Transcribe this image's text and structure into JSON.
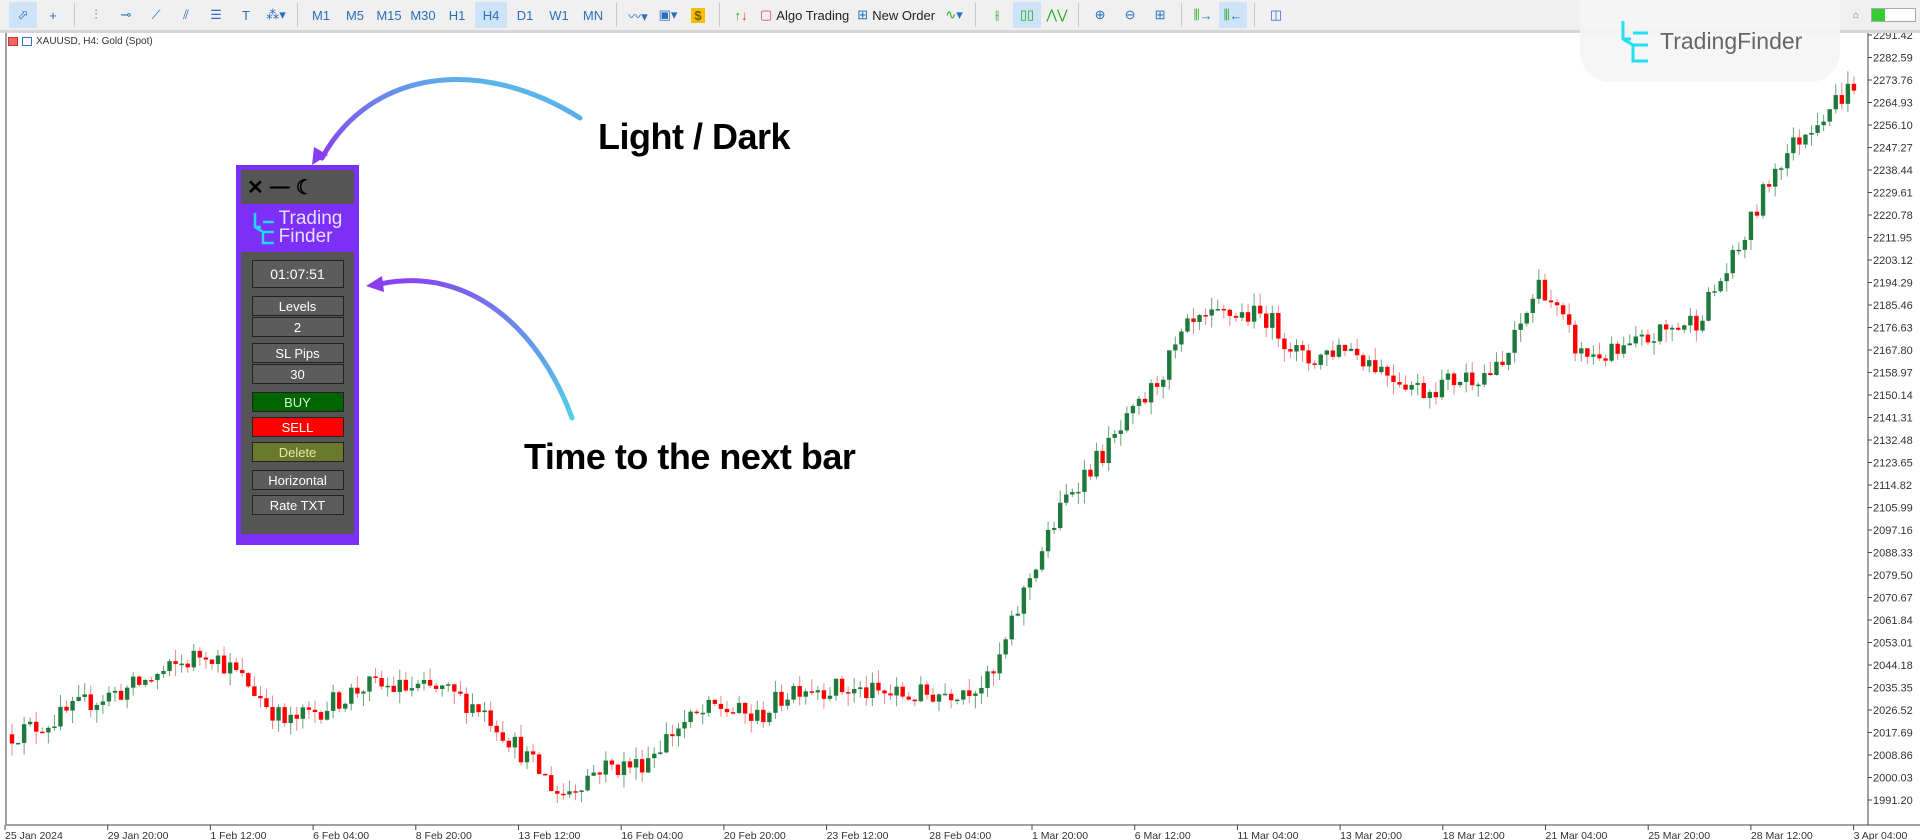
{
  "toolbar": {
    "tools": [
      "cursor-icon",
      "crosshair-icon",
      "vertical-line-icon",
      "horizontal-line-icon",
      "trendline-icon",
      "channel-icon",
      "fibonacci-icon",
      "text-icon",
      "shapes-icon"
    ],
    "timeframes": [
      "M1",
      "M5",
      "M15",
      "M30",
      "H1",
      "H4",
      "D1",
      "W1",
      "MN"
    ],
    "active_timeframe": "H4",
    "algo_trading": "Algo Trading",
    "new_order": "New Order"
  },
  "symbol_label": "XAUUSD, H4:  Gold (Spot)",
  "watermark": "TradingFinder",
  "panel": {
    "controls": [
      "✕",
      "—",
      "☾"
    ],
    "logo_line1": "Trading",
    "logo_line2": "Finder",
    "timer": "01:07:51",
    "levels_label": "Levels",
    "levels_value": "2",
    "sl_label": "SL Pips",
    "sl_value": "30",
    "buy": "BUY",
    "sell": "SELL",
    "delete": "Delete",
    "horizontal": "Horizontal",
    "rate_txt": "Rate TXT",
    "colors": {
      "frame": "#7b2ff7",
      "buy": "#006400",
      "sell": "#ff0000",
      "delete": "#6b7a2a"
    }
  },
  "annotations": {
    "light_dark": "Light / Dark",
    "timer": "Time to the next bar"
  },
  "chart_data": {
    "type": "candlestick",
    "symbol": "XAUUSD",
    "timeframe": "H4",
    "ylim": [
      1991.2,
      2291.42
    ],
    "y_ticks": [
      "2291.42",
      "2282.59",
      "2273.76",
      "2264.93",
      "2256.10",
      "2247.27",
      "2238.44",
      "2229.61",
      "2220.78",
      "2211.95",
      "2203.12",
      "2194.29",
      "2185.46",
      "2176.63",
      "2167.80",
      "2158.97",
      "2150.14",
      "2141.31",
      "2132.48",
      "2123.65",
      "2114.82",
      "2105.99",
      "2097.16",
      "2088.33",
      "2079.50",
      "2070.67",
      "2061.84",
      "2053.01",
      "2044.18",
      "2035.35",
      "2026.52",
      "2017.69",
      "2008.86",
      "2000.03",
      "1991.20"
    ],
    "x_ticks": [
      "25 Jan 2024",
      "29 Jan 20:00",
      "1 Feb 12:00",
      "6 Feb 04:00",
      "8 Feb 20:00",
      "13 Feb 12:00",
      "16 Feb 04:00",
      "20 Feb 20:00",
      "23 Feb 12:00",
      "28 Feb 04:00",
      "1 Mar 20:00",
      "6 Mar 12:00",
      "11 Mar 04:00",
      "13 Mar 20:00",
      "18 Mar 12:00",
      "21 Mar 04:00",
      "25 Mar 20:00",
      "28 Mar 12:00",
      "3 Apr 04:00"
    ],
    "approx_close": [
      2017,
      2022,
      2030,
      2035,
      2042,
      2050,
      2037,
      2021,
      2028,
      2036,
      2035,
      2034,
      2027,
      2010,
      1993,
      2004,
      2005,
      2020,
      2028,
      2023,
      2036,
      2035,
      2033,
      2032,
      2034,
      2038,
      2080,
      2113,
      2130,
      2150,
      2176,
      2182,
      2181,
      2163,
      2170,
      2160,
      2152,
      2157,
      2160,
      2195,
      2166,
      2166,
      2174,
      2180,
      2205,
      2240,
      2258,
      2272
    ],
    "colors": {
      "bull": "#1e7a3c",
      "bear": "#ff0000"
    },
    "grid": false
  }
}
